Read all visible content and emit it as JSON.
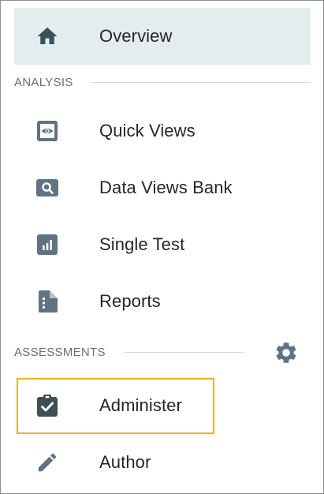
{
  "nav": {
    "overview": {
      "label": "Overview",
      "icon": "home-icon"
    },
    "analysis_title": "ANALYSIS",
    "analysis_items": [
      {
        "label": "Quick Views",
        "icon": "eye-icon"
      },
      {
        "label": "Data Views Bank",
        "icon": "search-icon"
      },
      {
        "label": "Single Test",
        "icon": "bar-chart-icon"
      },
      {
        "label": "Reports",
        "icon": "report-icon"
      }
    ],
    "assessments_title": "ASSESSMENTS",
    "assessments_settings_icon": "gear-icon",
    "assessments_items": [
      {
        "label": "Administer",
        "icon": "clipboard-check-icon"
      },
      {
        "label": "Author",
        "icon": "pencil-icon"
      }
    ]
  },
  "colors": {
    "active_background": "#e3ecef",
    "icon_dark": "#3d4f57",
    "icon": "#5f7480",
    "highlight_border": "#f0b22a",
    "label_text": "#262626",
    "section_text": "#6e6e6e"
  }
}
